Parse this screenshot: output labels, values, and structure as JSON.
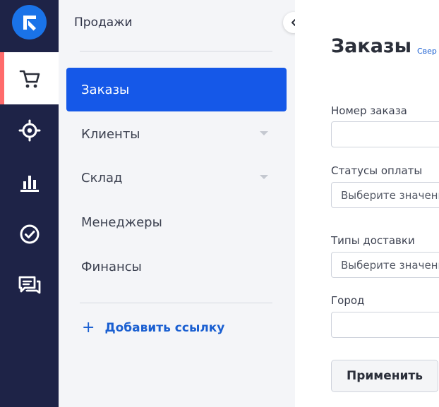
{
  "rail": {
    "items": [
      {
        "name": "orders",
        "icon": "cart-icon",
        "active": true
      },
      {
        "name": "target",
        "icon": "crosshair-icon"
      },
      {
        "name": "analytics",
        "icon": "bar-chart-icon"
      },
      {
        "name": "tasks",
        "icon": "check-circle-icon"
      },
      {
        "name": "chats",
        "icon": "chat-icon"
      }
    ],
    "accent": "#ff6b6b",
    "background": "#1e2347"
  },
  "sidebar": {
    "section_title": "Продажи",
    "items": [
      {
        "label": "Заказы",
        "active": true
      },
      {
        "label": "Клиенты",
        "has_submenu": true
      },
      {
        "label": "Склад",
        "has_submenu": true
      },
      {
        "label": "Менеджеры"
      },
      {
        "label": "Финансы"
      }
    ],
    "add_link": {
      "icon": "+",
      "label": "Добавить ссылку"
    },
    "active_color": "#1558e8"
  },
  "main": {
    "title": "Заказы",
    "title_link": "Свер",
    "filters": [
      {
        "label": "Номер заказа",
        "value": "",
        "placeholder": ""
      },
      {
        "label": "Статусы оплаты",
        "value": "",
        "placeholder": "Выберите значени"
      },
      {
        "label": "Типы доставки",
        "value": "",
        "placeholder": "Выберите значени"
      },
      {
        "label": "Город",
        "value": "",
        "placeholder": ""
      }
    ],
    "apply_label": "Применить"
  }
}
